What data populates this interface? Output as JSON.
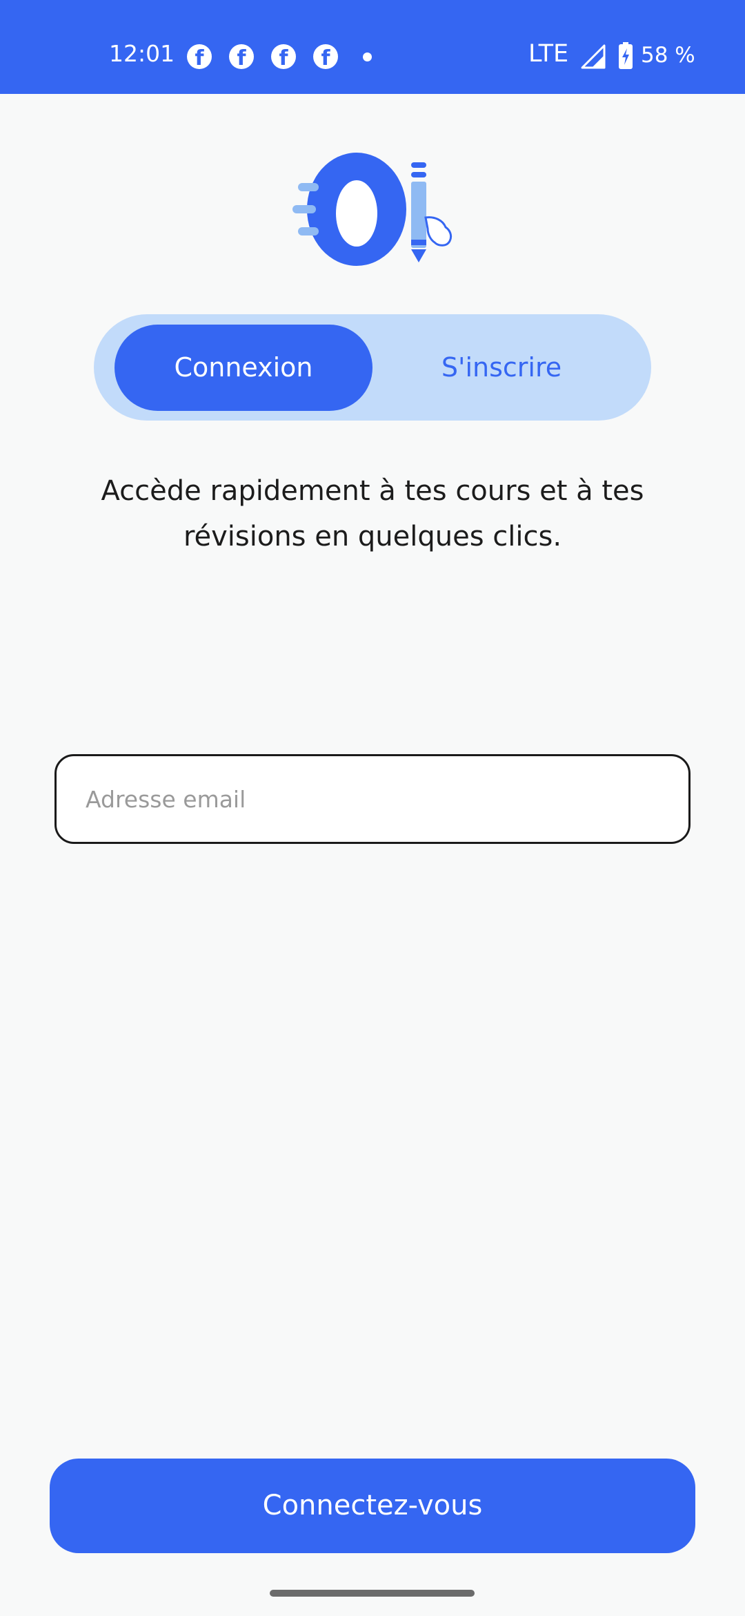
{
  "status_bar": {
    "time": "12:01",
    "network": "LTE",
    "battery": "58 %",
    "notification_icons": [
      "facebook-icon",
      "facebook-icon",
      "facebook-icon",
      "facebook-icon",
      "more-dot-icon"
    ]
  },
  "auth_tabs": {
    "login_label": "Connexion",
    "signup_label": "S'inscrire",
    "active": "login"
  },
  "tagline": "Accède rapidement à tes cours et à tes révisions en quelques clics.",
  "email_field": {
    "placeholder": "Adresse email",
    "value": ""
  },
  "submit_label": "Connectez-vous",
  "colors": {
    "primary": "#3566f2",
    "primary_light": "#c2dbfa",
    "background": "#f8f9f9",
    "text": "#1c1c1c"
  }
}
